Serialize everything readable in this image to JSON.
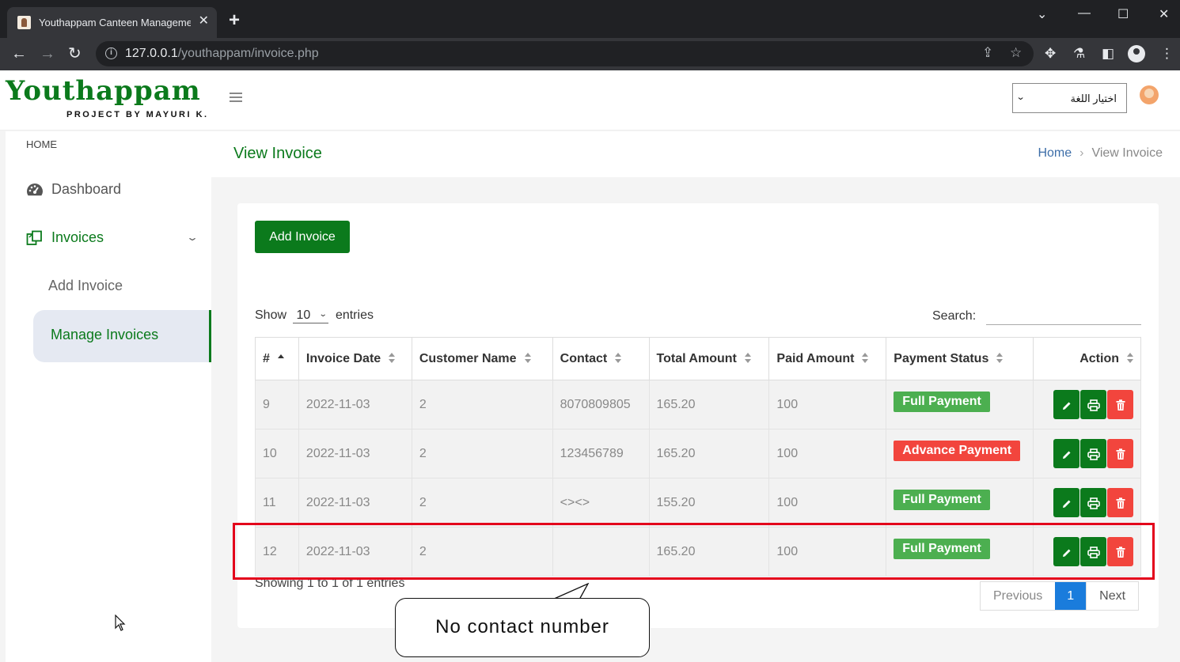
{
  "browser": {
    "tab_title": "Youthappam Canteen Management",
    "url_host": "127.0.0.1",
    "url_path": "/youthappam/invoice.php"
  },
  "header": {
    "logo": "Youthappam",
    "logo_sub": "PROJECT BY MAYURI K.",
    "language_select": "اختيار اللغة"
  },
  "sidebar": {
    "section": "HOME",
    "items": [
      {
        "label": "Dashboard",
        "icon": "dashboard-icon"
      },
      {
        "label": "Invoices",
        "icon": "invoices-icon"
      }
    ],
    "sub_items": [
      {
        "label": "Add Invoice"
      },
      {
        "label": "Manage Invoices",
        "active": true
      }
    ]
  },
  "page": {
    "title": "View Invoice",
    "breadcrumb": [
      "Home",
      "View Invoice"
    ]
  },
  "card": {
    "add_button": "Add Invoice",
    "show_label": "Show",
    "entries_value": "10",
    "entries_label": "entries",
    "search_label": "Search:",
    "info": "Showing 1 to 1 of 1 entries",
    "pagination": {
      "previous": "Previous",
      "current": "1",
      "next": "Next"
    }
  },
  "table": {
    "columns": [
      "#",
      "Invoice Date",
      "Customer Name",
      "Contact",
      "Total Amount",
      "Paid Amount",
      "Payment Status",
      "Action"
    ],
    "rows": [
      {
        "id": "9",
        "date": "2022-11-03",
        "customer": "2",
        "contact": "8070809805",
        "total": "165.20",
        "paid": "100",
        "status": "Full Payment",
        "status_color": "#4caf50"
      },
      {
        "id": "10",
        "date": "2022-11-03",
        "customer": "2",
        "contact": "123456789",
        "total": "165.20",
        "paid": "100",
        "status": "Advance Payment",
        "status_color": "#f2453d"
      },
      {
        "id": "11",
        "date": "2022-11-03",
        "customer": "2",
        "contact": "<><>",
        "total": "155.20",
        "paid": "100",
        "status": "Full Payment",
        "status_color": "#4caf50"
      },
      {
        "id": "12",
        "date": "2022-11-03",
        "customer": "2",
        "contact": "",
        "total": "165.20",
        "paid": "100",
        "status": "Full Payment",
        "status_color": "#4caf50"
      }
    ]
  },
  "annotation": {
    "callout": "No contact number",
    "highlight_color": "#e3001b"
  },
  "colors": {
    "brand_green": "#0b7a1c",
    "danger": "#f2453d",
    "pager_active": "#1a7cdc"
  }
}
